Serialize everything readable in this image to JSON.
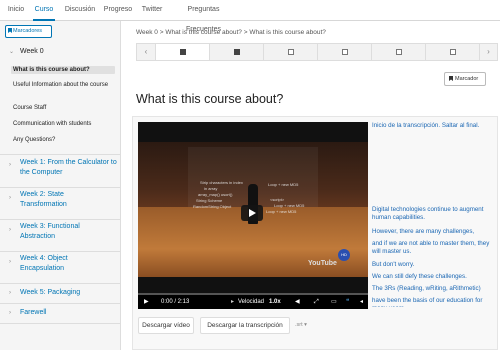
{
  "topnav": {
    "tabs": [
      {
        "label": "Inicio",
        "active": false
      },
      {
        "label": "Curso",
        "active": true
      },
      {
        "label": "Discusión",
        "active": false
      },
      {
        "label": "Progreso",
        "active": false
      },
      {
        "label": "Twitter",
        "active": false
      },
      {
        "label": "Preguntas Frecuentes",
        "active": false
      }
    ]
  },
  "sidebar": {
    "bookmarks_label": "Marcadores",
    "sections": [
      {
        "title": "Week 0",
        "open": true,
        "items": [
          {
            "label": "What is this course about?",
            "active": true
          },
          {
            "label": "Useful Information about the course",
            "active": false
          },
          {
            "label": "Course Staff",
            "active": false
          },
          {
            "label": "Communication with students",
            "active": false
          },
          {
            "label": "Any Questions?",
            "active": false
          }
        ]
      },
      {
        "title": "Week 1: From the Calculator to the Computer",
        "open": false
      },
      {
        "title": "Week 2: State Transformation",
        "open": false
      },
      {
        "title": "Week 3: Functional Abstraction",
        "open": false
      },
      {
        "title": "Week 4: Object Encapsulation",
        "open": false
      },
      {
        "title": "Week 5: Packaging",
        "open": false
      },
      {
        "title": "Farewell",
        "open": false
      }
    ]
  },
  "main": {
    "breadcrumb": "Week 0 > What is this course about? > What is this course about?",
    "bookmark_label": "Marcador",
    "page_title": "What is this course about?",
    "sequence_units": [
      "video",
      "video",
      "doc",
      "doc",
      "doc",
      "doc"
    ],
    "video": {
      "time": "0:00 / 2:13",
      "speed_label": "Velocidad",
      "speed_value": "1.0x",
      "progress": 0
    },
    "transcript": {
      "skip_label": "Inicio de la transcripción. Saltar al final.",
      "lines": [
        "Digital technologies continue to augment human capabilities.",
        "However, there are many challenges,",
        "and if we are not able to master them, they will master us.",
        "But don't worry.",
        "We can still defy these challenges.",
        "The 3Rs (Reading, wRiting, aRithmetic)",
        "have been the basis of our education for many years."
      ]
    },
    "download_video_label": "Descargar vídeo",
    "download_transcript_label": "Descargar la transcripción",
    "transcript_format": ".srt"
  }
}
